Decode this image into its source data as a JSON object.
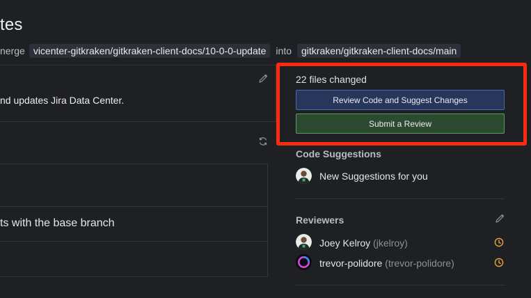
{
  "header": {
    "title": "tes",
    "merge_prefix": "nerge",
    "source_branch": "vicenter-gitkraken/gitkraken-client-docs/10-0-0-update",
    "into_label": "into",
    "target_branch": "gitkraken/gitkraken-client-docs/main"
  },
  "description": {
    "text": "nd updates Jira Data Center."
  },
  "checks": {
    "conflict_text": "ts with the base branch"
  },
  "sidebar": {
    "files_changed": "22 files changed",
    "review_code_label": "Review Code and Suggest Changes",
    "submit_review_label": "Submit a Review",
    "code_suggestions": {
      "title": "Code Suggestions",
      "item": "New Suggestions for you"
    },
    "reviewers": {
      "title": "Reviewers",
      "items": [
        {
          "name": "Joey Kelroy",
          "handle": "(jkelroy)"
        },
        {
          "name": "trevor-polidore",
          "handle": "(trevor-polidore)"
        }
      ]
    }
  },
  "colors": {
    "highlight": "#ff2a12",
    "pending": "#e8a23a",
    "primary_button": "#27365a",
    "success_button": "#2c4a2f"
  }
}
